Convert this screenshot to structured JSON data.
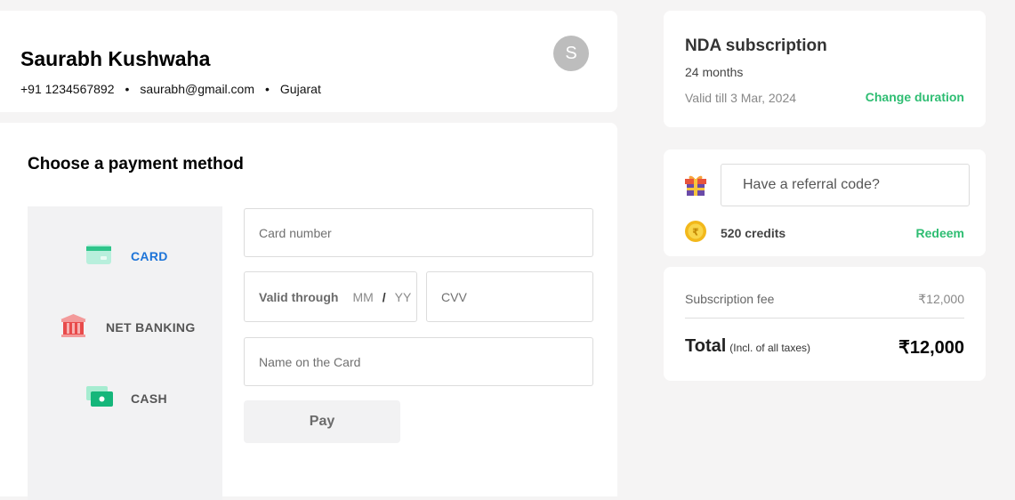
{
  "profile": {
    "name": "Saurabh Kushwaha",
    "phone": "+91 1234567892",
    "email": "saurabh@gmail.com",
    "state": "Gujarat",
    "avatar_initial": "S"
  },
  "payment": {
    "title": "Choose a payment method",
    "methods": [
      {
        "label": "CARD",
        "icon": "card-icon",
        "selected": true
      },
      {
        "label": "NET BANKING",
        "icon": "bank-icon",
        "selected": false
      },
      {
        "label": "CASH",
        "icon": "cash-icon",
        "selected": false
      }
    ],
    "card_number_placeholder": "Card number",
    "valid_through_label": "Valid through",
    "mm_placeholder": "MM",
    "separator": "/",
    "yy_placeholder": "YY",
    "cvv_placeholder": "CVV",
    "name_placeholder": "Name on the Card",
    "pay_label": "Pay"
  },
  "subscription": {
    "name": "NDA subscription",
    "duration": "24 months",
    "valid_till": "Valid till 3 Mar, 2024",
    "change_label": "Change duration"
  },
  "referral": {
    "placeholder": "Have a referral code?",
    "credits": "520 credits",
    "redeem_label": "Redeem"
  },
  "totals": {
    "fee_label": "Subscription fee",
    "fee_value": "₹12,000",
    "total_label": "Total",
    "total_note": "(Incl. of all taxes)",
    "total_value": "₹12,000"
  },
  "colors": {
    "accent_green": "#2ebd72",
    "selected_blue": "#1d74d8",
    "page_bg": "#f5f4f4"
  }
}
